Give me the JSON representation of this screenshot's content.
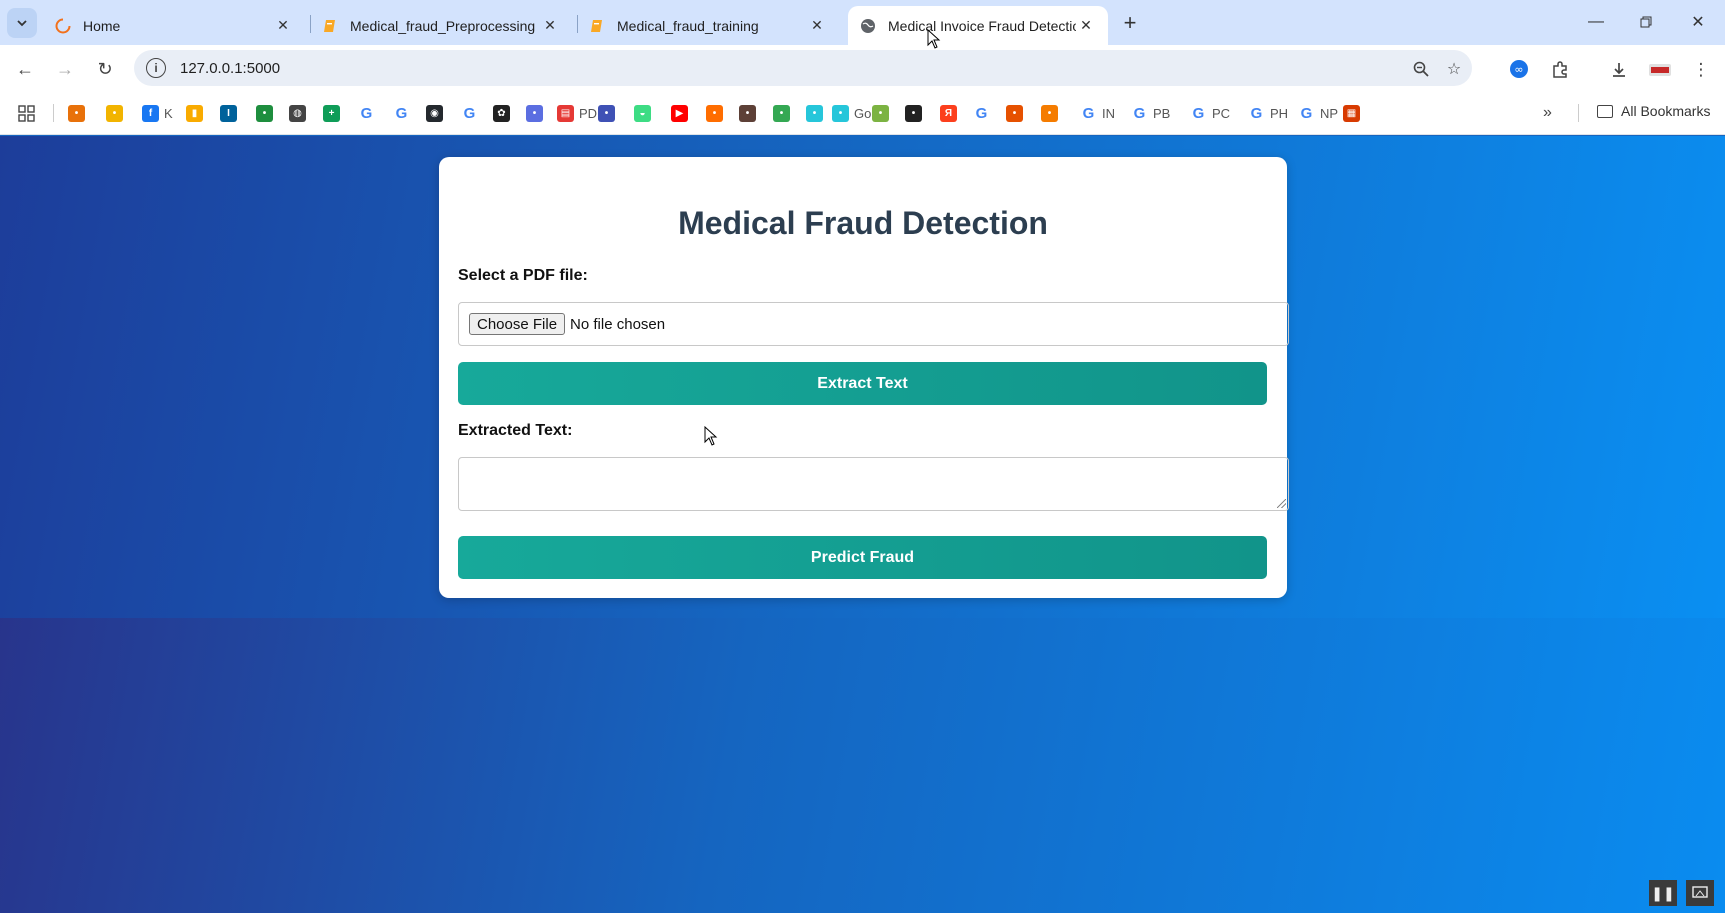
{
  "browser": {
    "tabs": [
      {
        "title": "Home",
        "favicon": "loading-spinner-icon",
        "active": false
      },
      {
        "title": "Medical_fraud_Preprocessing",
        "favicon": "notebook-icon",
        "active": false
      },
      {
        "title": "Medical_fraud_training",
        "favicon": "notebook-icon",
        "active": false
      },
      {
        "title": "Medical Invoice Fraud Detection",
        "favicon": "globe-icon",
        "active": true
      }
    ],
    "url": "127.0.0.1:5000",
    "bookmarks": [
      {
        "label": "",
        "icon": "bookmark-icon",
        "color": "#e8710a"
      },
      {
        "label": "",
        "icon": "bookmark-icon",
        "color": "#f2b400"
      },
      {
        "label": "K",
        "icon": "facebook-icon",
        "color": "#1877f2"
      },
      {
        "label": "",
        "icon": "analytics-icon",
        "color": "#f9ab00"
      },
      {
        "label": "",
        "icon": "ieee-icon",
        "color": "#00629b"
      },
      {
        "label": "",
        "icon": "bookmark-icon",
        "color": "#1e8e3e"
      },
      {
        "label": "",
        "icon": "globe-icon",
        "color": "#444444"
      },
      {
        "label": "",
        "icon": "sheets-icon",
        "color": "#0f9d58"
      },
      {
        "label": "",
        "icon": "google-icon",
        "color": "#4285f4"
      },
      {
        "label": "",
        "icon": "google-icon",
        "color": "#4285f4"
      },
      {
        "label": "",
        "icon": "github-icon",
        "color": "#24292e"
      },
      {
        "label": "",
        "icon": "google-icon",
        "color": "#4285f4"
      },
      {
        "label": "",
        "icon": "openai-icon",
        "color": "#222222"
      },
      {
        "label": "",
        "icon": "bookmark-icon",
        "color": "#5b6ee1"
      },
      {
        "label": "PDF",
        "icon": "pdf-icon",
        "color": "#e53935"
      },
      {
        "label": "",
        "icon": "bookmark-icon",
        "color": "#3f51b5"
      },
      {
        "label": "",
        "icon": "android-icon",
        "color": "#3ddc84"
      },
      {
        "label": "",
        "icon": "youtube-icon",
        "color": "#ff0000"
      },
      {
        "label": "",
        "icon": "bookmark-icon",
        "color": "#ff6d00"
      },
      {
        "label": "",
        "icon": "bookmark-icon",
        "color": "#5d4037"
      },
      {
        "label": "",
        "icon": "bookmark-icon",
        "color": "#34a853"
      },
      {
        "label": "",
        "icon": "bookmark-icon",
        "color": "#26c6da"
      },
      {
        "label": "Go",
        "icon": "bookmark-icon",
        "color": "#26c6da"
      },
      {
        "label": "",
        "icon": "bookmark-icon",
        "color": "#7cb342"
      },
      {
        "label": "",
        "icon": "bookmark-icon",
        "color": "#222222"
      },
      {
        "label": "",
        "icon": "yandex-icon",
        "color": "#fc3f1d"
      },
      {
        "label": "",
        "icon": "google-icon",
        "color": "#4285f4"
      },
      {
        "label": "",
        "icon": "bookmark-icon",
        "color": "#e65100"
      },
      {
        "label": "",
        "icon": "bookmark-icon",
        "color": "#f57c00"
      },
      {
        "label": "IN",
        "icon": "google-icon",
        "color": "#4285f4"
      },
      {
        "label": "PB",
        "icon": "google-icon",
        "color": "#4285f4"
      },
      {
        "label": "PC",
        "icon": "google-icon",
        "color": "#4285f4"
      },
      {
        "label": "PH",
        "icon": "google-icon",
        "color": "#4285f4"
      },
      {
        "label": "NP",
        "icon": "google-icon",
        "color": "#4285f4"
      },
      {
        "label": "",
        "icon": "office-icon",
        "color": "#d83b01"
      }
    ],
    "all_bookmarks": "All Bookmarks"
  },
  "app": {
    "title": "Medical Fraud Detection",
    "file_label": "Select a PDF file:",
    "choose_file": "Choose File",
    "no_file": "No file chosen",
    "extract_button": "Extract Text",
    "extracted_label": "Extracted Text:",
    "extracted_text": "",
    "predict_button": "Predict Fraud"
  }
}
